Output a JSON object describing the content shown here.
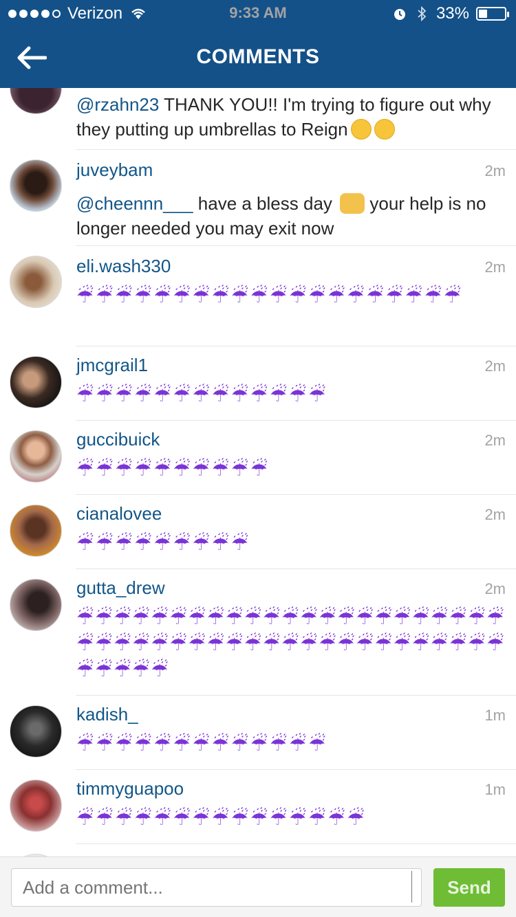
{
  "status": {
    "carrier": "Verizon",
    "time": "9:33 AM",
    "battery": "33%",
    "battery_level": 0.33
  },
  "nav": {
    "title": "COMMENTS",
    "back_icon": "arrow-left-icon"
  },
  "colors": {
    "header_bg": "#145189",
    "username": "#125688",
    "send_green": "#6ebd34",
    "umbrella_purple": "#7b34d6"
  },
  "comments": [
    {
      "username": "",
      "time": "",
      "mention": "@rzahn23",
      "text": " THANK YOU!! I'm trying to figure out why they putting up umbrellas to Reign",
      "emojis": [
        "hushed-face",
        "confused-face"
      ]
    },
    {
      "username": "juveybam",
      "time": "2m",
      "mention": "@cheennn___",
      "text_before": " have a bless day",
      "text_after": " your help is no longer needed you may exit now",
      "emojis": [
        "raised-hands"
      ]
    },
    {
      "username": "eli.wash330",
      "time": "2m",
      "umbrellas": "☔☔☔☔☔☔☔☔☔☔☔☔☔☔☔☔☔☔☔☔"
    },
    {
      "username": "jmcgrail1",
      "time": "2m",
      "umbrellas": "☔☔☔☔☔☔☔☔☔☔☔☔☔"
    },
    {
      "username": "guccibuick",
      "time": "2m",
      "umbrellas": "☔☔☔☔☔☔☔☔☔☔"
    },
    {
      "username": "cianalovee",
      "time": "2m",
      "umbrellas": "☔☔☔☔☔☔☔☔☔"
    },
    {
      "username": "gutta_drew",
      "time": "2m",
      "umbrellas": "☔☔☔☔☔☔☔☔☔☔☔☔☔☔☔☔☔☔☔☔☔☔☔☔☔☔☔☔☔☔☔☔☔☔☔☔☔☔☔☔☔☔☔☔☔☔☔☔☔☔☔"
    },
    {
      "username": "kadish_",
      "time": "1m",
      "umbrellas": "☔☔☔☔☔☔☔☔☔☔☔☔☔"
    },
    {
      "username": "timmyguapoo",
      "time": "1m",
      "umbrellas": "☔☔☔☔☔☔☔☔☔☔☔☔☔☔☔"
    }
  ],
  "composer": {
    "placeholder": "Add a comment...",
    "send_label": "Send"
  }
}
